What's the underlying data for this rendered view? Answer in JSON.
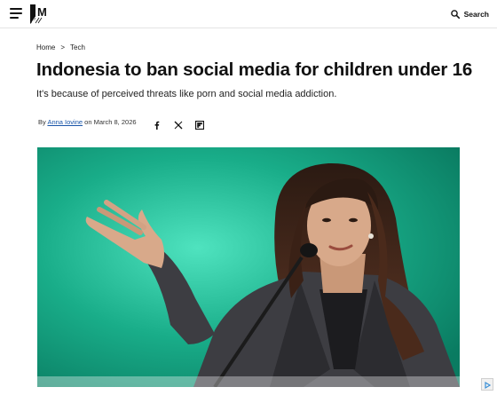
{
  "header": {
    "menu_icon": "hamburger-menu-icon",
    "logo_text": "M",
    "search_label": "Search",
    "search_icon": "search-icon"
  },
  "breadcrumb": {
    "items": [
      "Home",
      "Tech"
    ],
    "separator": ">"
  },
  "article": {
    "title": "Indonesia to ban social media for children under 16",
    "subtitle": "It's because of perceived threats like porn and social media addiction.",
    "byline_prefix": "By",
    "author": "Anna Iovine",
    "date_prefix": "on",
    "date": "March 8, 2026",
    "share_icons": [
      "facebook-icon",
      "x-twitter-icon",
      "flipboard-icon"
    ]
  },
  "colors": {
    "text": "#111111",
    "link": "#1a55a8",
    "hero_background": "#1fb38e"
  }
}
